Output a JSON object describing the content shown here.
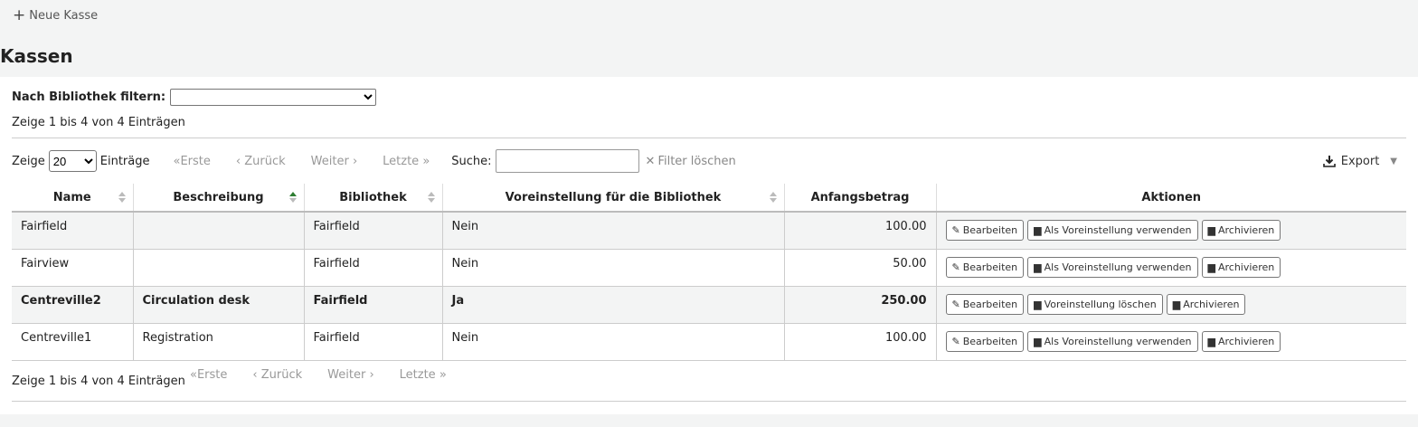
{
  "toolbar": {
    "new_label": "Neue Kasse"
  },
  "page_title": "Kassen",
  "filter": {
    "label": "Nach Bibliothek filtern:",
    "selected": ""
  },
  "info_text": "Zeige 1 bis 4 von 4 Einträgen",
  "controls": {
    "show_label": "Zeige",
    "length_value": "20",
    "entries_label": "Einträge",
    "first": "Erste",
    "prev": "Zurück",
    "next": "Weiter",
    "last": "Letzte",
    "search_label": "Suche:",
    "search_value": "",
    "clear_filter": "Filter löschen",
    "export": "Export"
  },
  "columns": [
    "Name",
    "Beschreibung",
    "Bibliothek",
    "Voreinstellung für die Bibliothek",
    "Anfangsbetrag",
    "Aktionen"
  ],
  "rows": [
    {
      "name": "Fairfield",
      "description": "",
      "library": "Fairfield",
      "default": "Nein",
      "amount": "100.00",
      "edit": "Bearbeiten",
      "toggle": "Als Voreinstellung verwenden",
      "archive": "Archivieren"
    },
    {
      "name": "Fairview",
      "description": "",
      "library": "Fairfield",
      "default": "Nein",
      "amount": "50.00",
      "edit": "Bearbeiten",
      "toggle": "Als Voreinstellung verwenden",
      "archive": "Archivieren"
    },
    {
      "name": "Centreville2",
      "description": "Circulation desk",
      "library": "Fairfield",
      "default": "Ja",
      "amount": "250.00",
      "edit": "Bearbeiten",
      "toggle": "Voreinstellung löschen",
      "archive": "Archivieren"
    },
    {
      "name": "Centreville1",
      "description": "Registration",
      "library": "Fairfield",
      "default": "Nein",
      "amount": "100.00",
      "edit": "Bearbeiten",
      "toggle": "Als Voreinstellung verwenden",
      "archive": "Archivieren"
    }
  ],
  "colors": {
    "sort_active": "#2e7d32",
    "sort_inactive": "#bbbbbb",
    "row_alt_bg": "#f3f4f4"
  }
}
